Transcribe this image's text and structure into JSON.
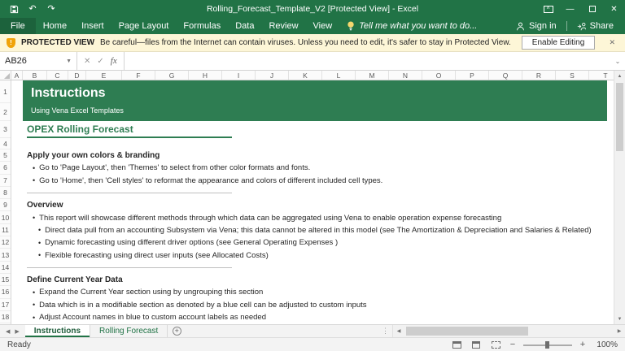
{
  "title_bar": {
    "title": "Rolling_Forecast_Template_V2  [Protected View] - Excel"
  },
  "ribbon": {
    "file": "File",
    "tabs": [
      "Home",
      "Insert",
      "Page Layout",
      "Formulas",
      "Data",
      "Review",
      "View"
    ],
    "tell_me": "Tell me what you want to do...",
    "sign_in": "Sign in",
    "share": "Share"
  },
  "protected_view": {
    "title": "PROTECTED VIEW",
    "message": "Be careful—files from the Internet can contain viruses. Unless you need to edit, it's safer to stay in Protected View.",
    "button": "Enable Editing"
  },
  "formula_bar": {
    "name_box": "AB26",
    "cancel": "✕",
    "confirm": "✓",
    "fx": "fx"
  },
  "grid": {
    "columns": [
      "A",
      "B",
      "C",
      "D",
      "E",
      "F",
      "G",
      "H",
      "I",
      "J",
      "K",
      "L",
      "M",
      "N",
      "O",
      "P",
      "Q",
      "R",
      "S",
      "T"
    ],
    "rows": [
      "1",
      "2",
      "3",
      "4",
      "5",
      "6",
      "7",
      "8",
      "9",
      "10",
      "11",
      "12",
      "13",
      "14",
      "15",
      "16",
      "17",
      "18"
    ]
  },
  "sheet": {
    "banner": {
      "title": "Instructions",
      "subtitle": "Using Vena Excel Templates"
    },
    "heading": "OPEX Rolling Forecast",
    "lines": [
      {
        "type": "heading",
        "text": "Apply your own colors & branding"
      },
      {
        "type": "bullet",
        "text": "Go to 'Page Layout', then 'Themes' to select from other color formats and fonts."
      },
      {
        "type": "bullet",
        "text": "Go to 'Home', then 'Cell styles' to reformat the appearance and colors of different included cell types."
      },
      {
        "type": "divider",
        "text": ""
      },
      {
        "type": "heading",
        "text": "Overview"
      },
      {
        "type": "bullet",
        "text": "This report will showcase different methods through which data can be aggregated using Vena to enable operation expense forecasting"
      },
      {
        "type": "bullet2",
        "text": "Direct data pull from an accounting Subsystem via Vena; this data cannot be altered in this model (see The Amortization & Depreciation and Salaries & Related)"
      },
      {
        "type": "bullet2",
        "text": "Dynamic forecasting  using different driver options (see General Operating Expenses )"
      },
      {
        "type": "bullet2",
        "text": "Flexible forecasting using direct user inputs (see Allocated Costs)"
      },
      {
        "type": "divider",
        "text": ""
      },
      {
        "type": "heading",
        "text": "Define Current Year Data"
      },
      {
        "type": "bullet",
        "text": "Expand the Current Year section using by ungrouping this section"
      },
      {
        "type": "bullet",
        "text": "Data which is in a modifiable section as denoted by a blue cell can be adjusted to custom inputs"
      },
      {
        "type": "bullet",
        "text": "Adjust Account names in blue to custom account labels as needed"
      }
    ]
  },
  "sheet_tabs": {
    "tabs": [
      {
        "label": "Instructions",
        "active": true
      },
      {
        "label": "Rolling Forecast",
        "active": false
      }
    ]
  },
  "status_bar": {
    "ready": "Ready",
    "zoom": "100%"
  },
  "colors": {
    "excel_green": "#217346",
    "banner_green": "#2E7D52",
    "protected_view_bg": "#FDF6D7",
    "shield_orange": "#F0A30A"
  }
}
